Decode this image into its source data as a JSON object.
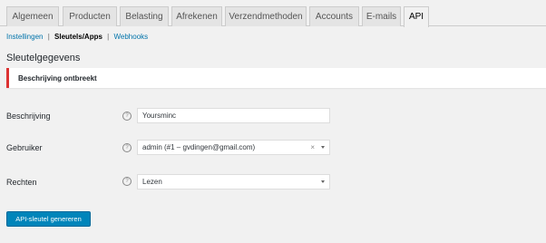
{
  "tabs": [
    {
      "label": "Algemeen"
    },
    {
      "label": "Producten"
    },
    {
      "label": "Belasting"
    },
    {
      "label": "Afrekenen"
    },
    {
      "label": "Verzendmethoden"
    },
    {
      "label": "Accounts"
    },
    {
      "label": "E-mails"
    },
    {
      "label": "API"
    }
  ],
  "subnav": {
    "settings": "Instellingen",
    "keys_apps": "Sleutels/Apps",
    "webhooks": "Webhooks",
    "separator": "|"
  },
  "heading": "Sleutelgegevens",
  "notice": "Beschrijving ontbreekt",
  "form": {
    "description_label": "Beschrijving",
    "description_value": "Yoursminc",
    "user_label": "Gebruiker",
    "user_value": "admin (#1 – gvdingen@gmail.com)",
    "user_clear": "×",
    "permissions_label": "Rechten",
    "permissions_value": "Lezen",
    "help_glyph": "?"
  },
  "button": "API-sleutel genereren",
  "colors": {
    "notice_border": "#dc3232",
    "button": "#0085ba",
    "link": "#0073aa",
    "background": "#f1f1f1"
  }
}
